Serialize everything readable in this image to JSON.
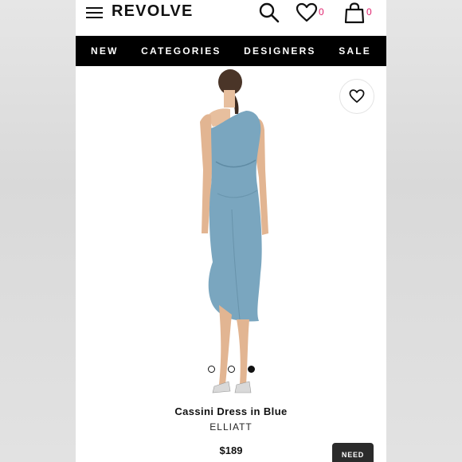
{
  "header": {
    "logo": "REVOLVE",
    "wishlist_count": "0",
    "bag_count": "0"
  },
  "nav": {
    "items": [
      "NEW",
      "CATEGORIES",
      "DESIGNERS",
      "SALE"
    ]
  },
  "product": {
    "title": "Cassini Dress in Blue",
    "brand": "ELLIATT",
    "price": "$189",
    "image_count": 3,
    "active_image_index": 3
  },
  "cta": {
    "label": "NEED"
  },
  "colors": {
    "accent": "#e0226e",
    "nav_bg": "#000000",
    "dress": "#7aa6bf"
  }
}
